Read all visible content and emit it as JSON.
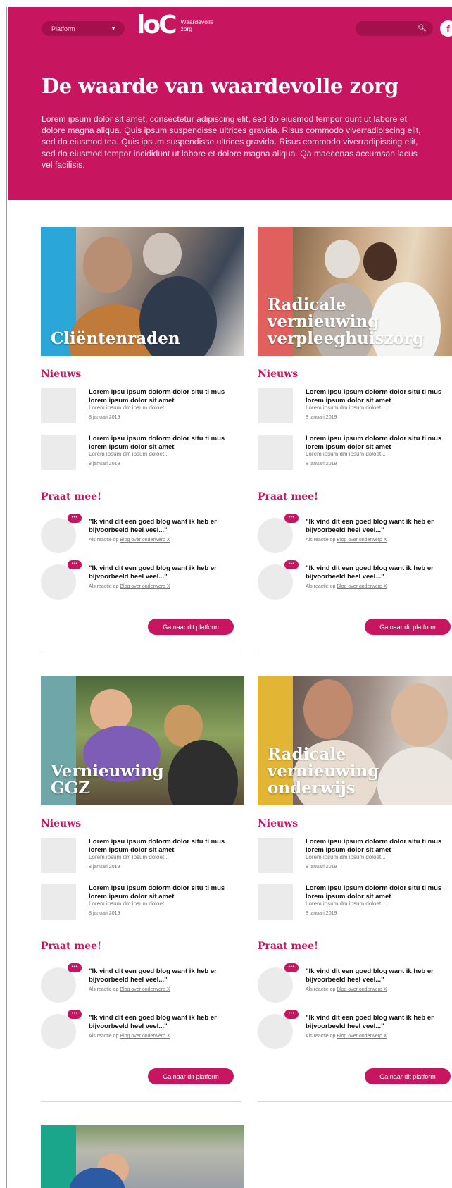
{
  "header": {
    "platform_label": "Platform",
    "logo_mark": "loC",
    "logo_text": "Waardevolle zorg",
    "search_placeholder": "",
    "facebook_label": "f"
  },
  "hero": {
    "title": "De waarde van waardevolle zorg",
    "text": "Lorem ipsum dolor sit amet, consectetur adipiscing elit, sed do eiusmod tempor dunt ut labore et dolore magna aliqua. Quis ipsum suspendisse ultrices gravida. Risus commodo viverradipiscing elit, sed do eiusmod tea. Quis ipsum suspendisse ultrices gravida. Risus commodo viverradipiscing elit, sed do eiusmod tempor incididunt ut labore et dolore magna aliqua. Qa maecenas accumsan lacus vel facilisis."
  },
  "labels": {
    "news": "Nieuws",
    "talk": "Praat mee!",
    "cta": "Ga naar dit platform",
    "news_title": "Lorem ipsu ipsum dolorm dolor situ ti mus lorem ipsum dolor sit amet",
    "news_sub": "Lorem ipsum dm ipsum doloet...",
    "news_date": "8 januari 2019",
    "quote": "\"Ik vind dit een goed blog want ik heb er bijvoorbeeld heel veel...\"",
    "reply_prefix": "Als reactie op ",
    "reply_link": "Blog over onderwerp X",
    "bubble": "•••"
  },
  "cards": [
    {
      "title": "Cliëntenraden",
      "stripe": "#2aa6d8"
    },
    {
      "title": "Radicale vernieuwing verpleeghuiszorg",
      "stripe": "#e0605e"
    },
    {
      "title": "Vernieuwing GGZ",
      "stripe": "#6fa6a8"
    },
    {
      "title": "Radicale vernieuwing onderwijs",
      "stripe": "#e2b535"
    },
    {
      "title": "",
      "stripe": "#1aa68a"
    }
  ],
  "colors": {
    "brand": "#c8155f",
    "brand_dark": "#a3104c"
  }
}
